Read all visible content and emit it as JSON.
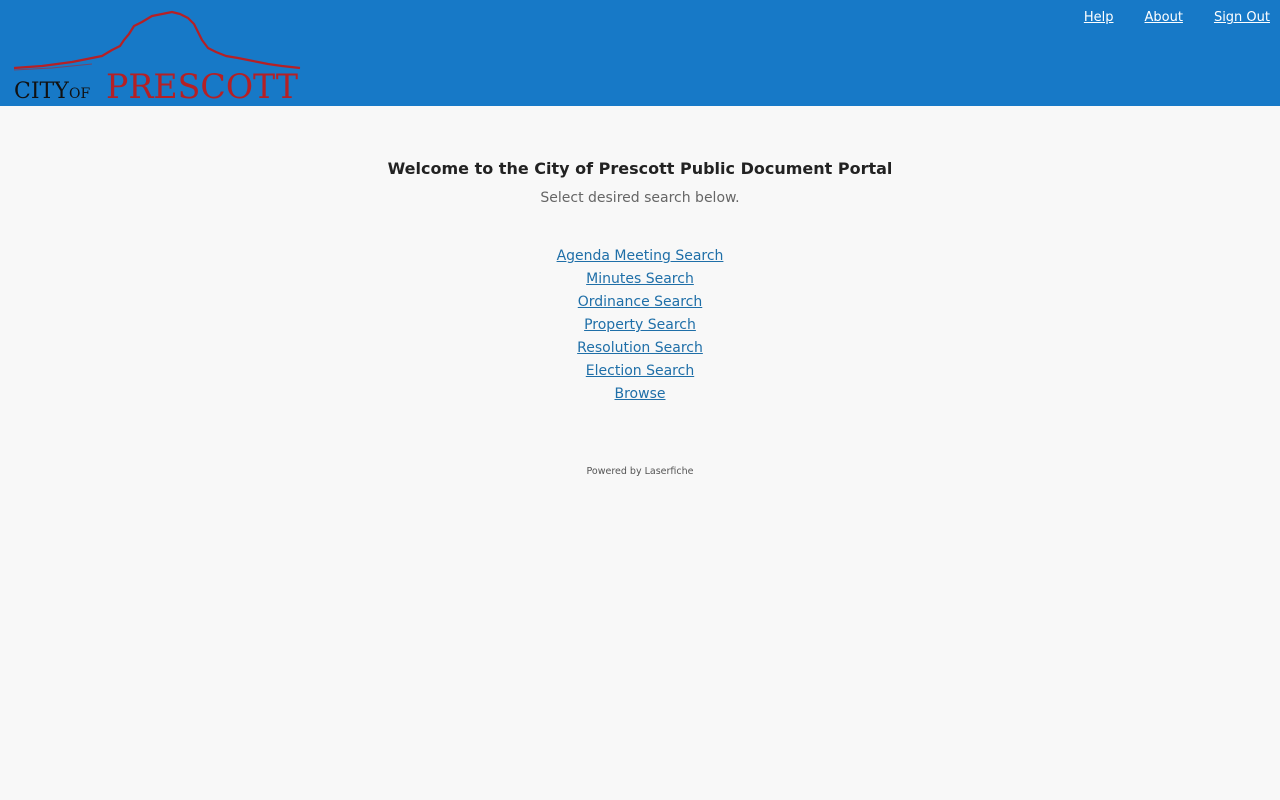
{
  "header": {
    "logo": {
      "text_city": "CITY",
      "text_of": "OF",
      "text_name": "PRESCOTT",
      "icon": "mountain-skyline-logo"
    },
    "nav": [
      {
        "label": "Help"
      },
      {
        "label": "About"
      },
      {
        "label": "Sign Out"
      }
    ],
    "background_color": "#1779c7"
  },
  "main": {
    "title": "Welcome to the City of Prescott Public Document Portal",
    "subtitle": "Select desired search below.",
    "links": [
      {
        "label": "Agenda Meeting Search"
      },
      {
        "label": "Minutes Search"
      },
      {
        "label": "Ordinance Search"
      },
      {
        "label": "Property Search"
      },
      {
        "label": "Resolution Search"
      },
      {
        "label": "Election Search"
      },
      {
        "label": "Browse"
      }
    ],
    "link_color": "#1f6fa8"
  },
  "footer": {
    "text": "Powered by Laserfiche"
  }
}
